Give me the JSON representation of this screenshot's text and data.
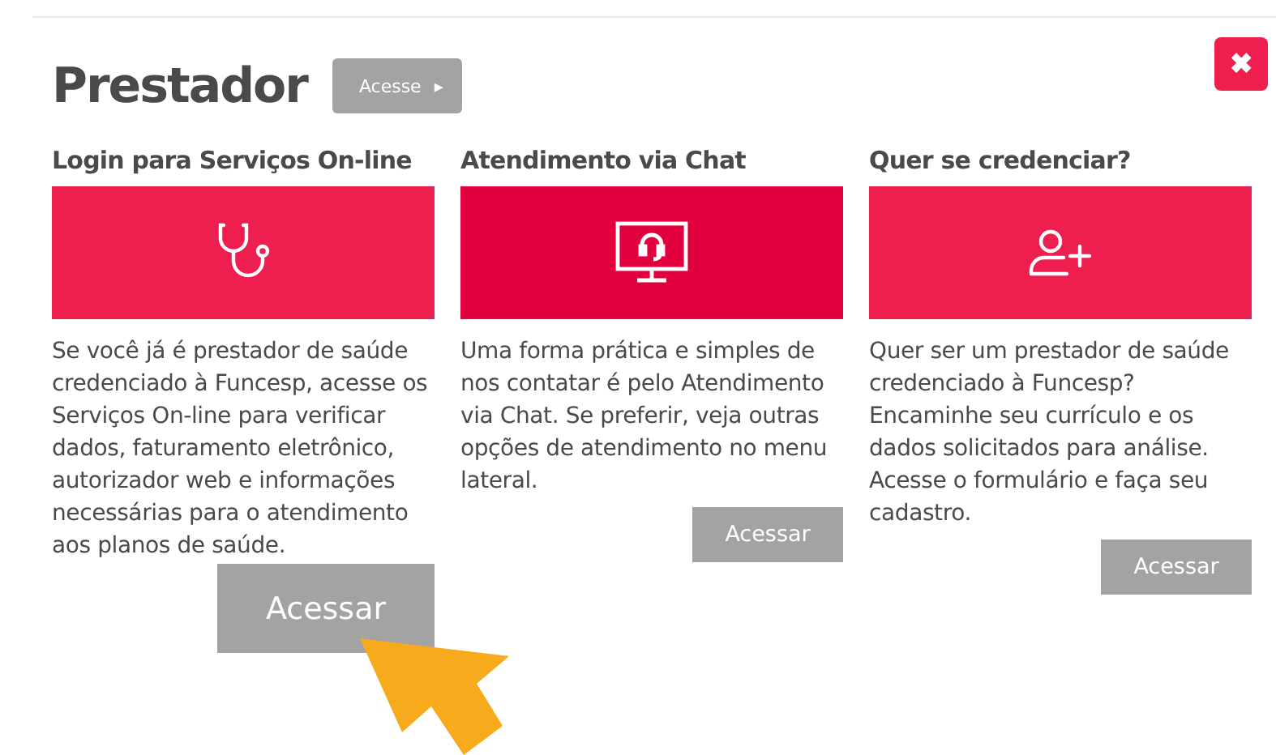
{
  "title": "Prestador",
  "title_button": {
    "label": "Acesse",
    "icon": "▸"
  },
  "close_button": {
    "label": "✖"
  },
  "columns": [
    {
      "heading": "Login para Serviços On-line",
      "hovered": false,
      "text": "Se você já é prestador de saúde credenciado à Funcesp, acesse os Serviços On-line para verificar dados, faturamento eletrônico, autorizador web e informações necessárias para o atendimento aos planos de saúde.",
      "button": {
        "label": "Acessar",
        "kind": "enlarged"
      }
    },
    {
      "heading": "Atendimento via Chat",
      "hovered": true,
      "text": "Uma forma prática e simples de nos contatar é pelo Atendimento via Chat. Se preferir, veja outras opções de atendimento no menu lateral.",
      "button": {
        "label": "Acessar",
        "kind": "normal"
      }
    },
    {
      "heading": "Quer se credenciar?",
      "hovered": false,
      "text": "Quer ser um prestador de saúde credenciado à Funcesp? Encaminhe seu currículo e os dados solicitados para análise. Acesse o formulário e faça seu cadastro.",
      "button": {
        "label": "Acessar",
        "kind": "normal"
      }
    }
  ]
}
